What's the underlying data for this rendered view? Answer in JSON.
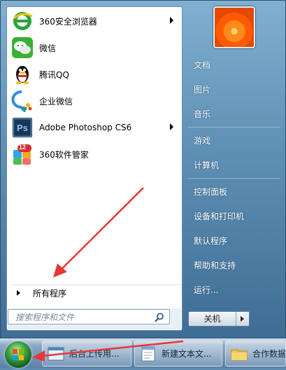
{
  "start_menu": {
    "programs": [
      {
        "label": "360安全浏览器",
        "has_submenu": true,
        "icon": "browser-360-icon"
      },
      {
        "label": "微信",
        "has_submenu": false,
        "icon": "wechat-icon"
      },
      {
        "label": "腾讯QQ",
        "has_submenu": false,
        "icon": "qq-penguin-icon"
      },
      {
        "label": "企业微信",
        "has_submenu": false,
        "icon": "wecom-icon"
      },
      {
        "label": "Adobe Photoshop CS6",
        "has_submenu": true,
        "icon": "photoshop-icon"
      },
      {
        "label": "360软件管家",
        "has_submenu": false,
        "icon": "software-manager-360-icon",
        "badge": "12"
      }
    ],
    "all_programs_label": "所有程序",
    "search_placeholder": "搜索程序和文件",
    "right_links": [
      {
        "label": "文档"
      },
      {
        "label": "图片"
      },
      {
        "label": "音乐"
      },
      {
        "label": "游戏"
      },
      {
        "label": "计算机"
      },
      {
        "label": "控制面板"
      },
      {
        "label": "设备和打印机"
      },
      {
        "label": "默认程序"
      },
      {
        "label": "帮助和支持"
      },
      {
        "label": "运行..."
      }
    ],
    "shutdown_label": "关机"
  },
  "taskbar": {
    "buttons": [
      {
        "label": "后台上传用...",
        "icon": "window-icon"
      },
      {
        "label": "新建文本文...",
        "icon": "notepad-icon"
      },
      {
        "label": "合作数据",
        "icon": "folder-icon"
      }
    ]
  },
  "colors": {
    "annotation_arrow": "#e53935",
    "menu_blue": "#5e8fb4"
  }
}
